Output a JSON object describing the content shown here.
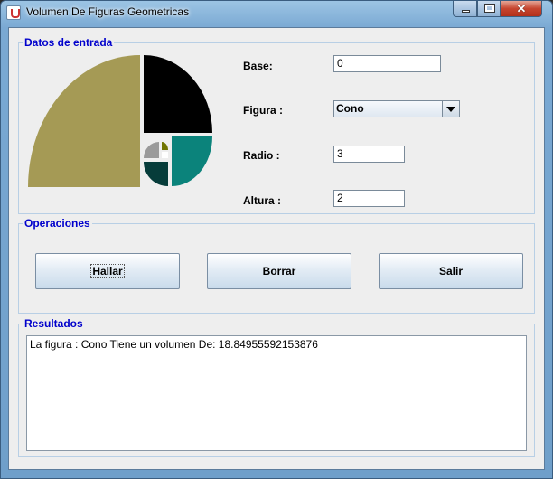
{
  "window": {
    "title": "Volumen De Figuras Geometricas",
    "controls": {
      "minimize_icon": "minimize-icon",
      "maximize_icon": "maximize-icon",
      "close_label": "✕"
    }
  },
  "input_group": {
    "legend": "Datos de entrada",
    "base_label": "Base:",
    "base_value": "0",
    "figure_label": "Figura :",
    "figure_selected": "Cono",
    "radius_label": "Radio :",
    "radius_value": "3",
    "height_label": "Altura :",
    "height_value": "2"
  },
  "operations_group": {
    "legend": "Operaciones",
    "buttons": [
      "Hallar",
      "Borrar",
      "Salir"
    ]
  },
  "results_group": {
    "legend": "Resultados",
    "output": "La figura : Cono Tiene un volumen De: 18.84955592153876"
  },
  "colors": {
    "legend_text": "#0000cc",
    "logo_gold": "#a59a55",
    "logo_black": "#000000",
    "logo_teal": "#0b837b",
    "logo_dark": "#063c3a",
    "logo_gray": "#9a9a9a",
    "logo_olive": "#707400"
  }
}
